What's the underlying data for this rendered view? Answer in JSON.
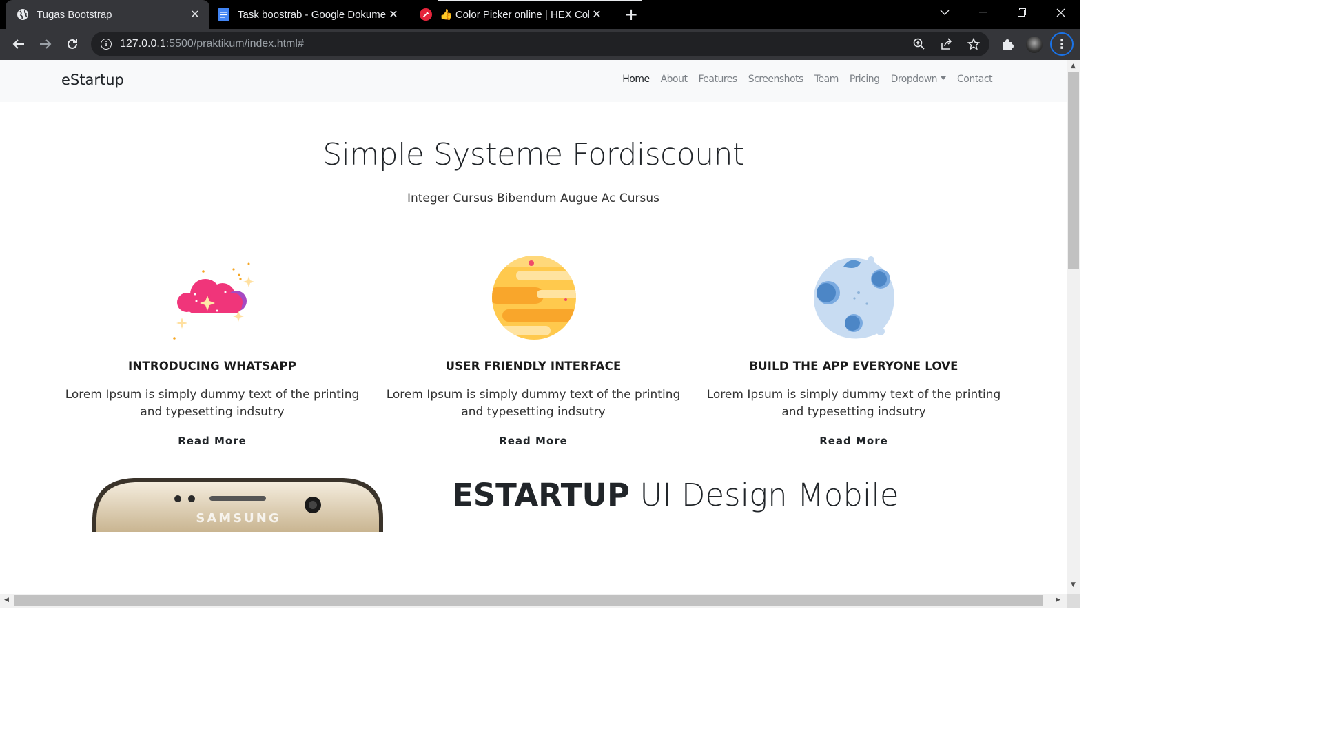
{
  "browser": {
    "tabs": [
      {
        "title": "Tugas Bootstrap",
        "icon": "globe-icon",
        "active": true
      },
      {
        "title": "Task boostrab - Google Dokumen",
        "icon": "google-docs-icon",
        "active": false
      },
      {
        "title": "👍 Color Picker online | HEX Color",
        "icon": "color-picker-icon",
        "active": false
      }
    ],
    "url_host": "127.0.0.1",
    "url_rest": ":5500/praktikum/index.html#",
    "colors": {
      "chrome_bg": "#000000",
      "toolbar_bg": "#35363a",
      "accent": "#1a73e8"
    }
  },
  "site": {
    "brand": "eStartup",
    "nav": [
      "Home",
      "About",
      "Features",
      "Screenshots",
      "Team",
      "Pricing",
      "Dropdown",
      "Contact"
    ],
    "hero": {
      "title": "Simple Systeme Fordiscount",
      "subtitle": "Integer Cursus Bibendum Augue Ac Cursus"
    },
    "features": [
      {
        "icon": "cloud-stars-icon",
        "heading": "INTRODUCING WHATSAPP",
        "text": "Lorem Ipsum is simply dummy text of the printing and typesetting indsutry",
        "link": "Read More"
      },
      {
        "icon": "planet-icon",
        "heading": "USER FRIENDLY INTERFACE",
        "text": "Lorem Ipsum is simply dummy text of the printing and typesetting indsutry",
        "link": "Read More"
      },
      {
        "icon": "moon-icon",
        "heading": "BUILD THE APP EVERYONE LOVE",
        "text": "Lorem Ipsum is simply dummy text of the printing and typesetting indsutry",
        "link": "Read More"
      }
    ],
    "mobile_section": {
      "title_bold": "ESTARTUP",
      "title_rest": " UI Design Mobile",
      "phone_brand": "SAMSUNG"
    }
  }
}
